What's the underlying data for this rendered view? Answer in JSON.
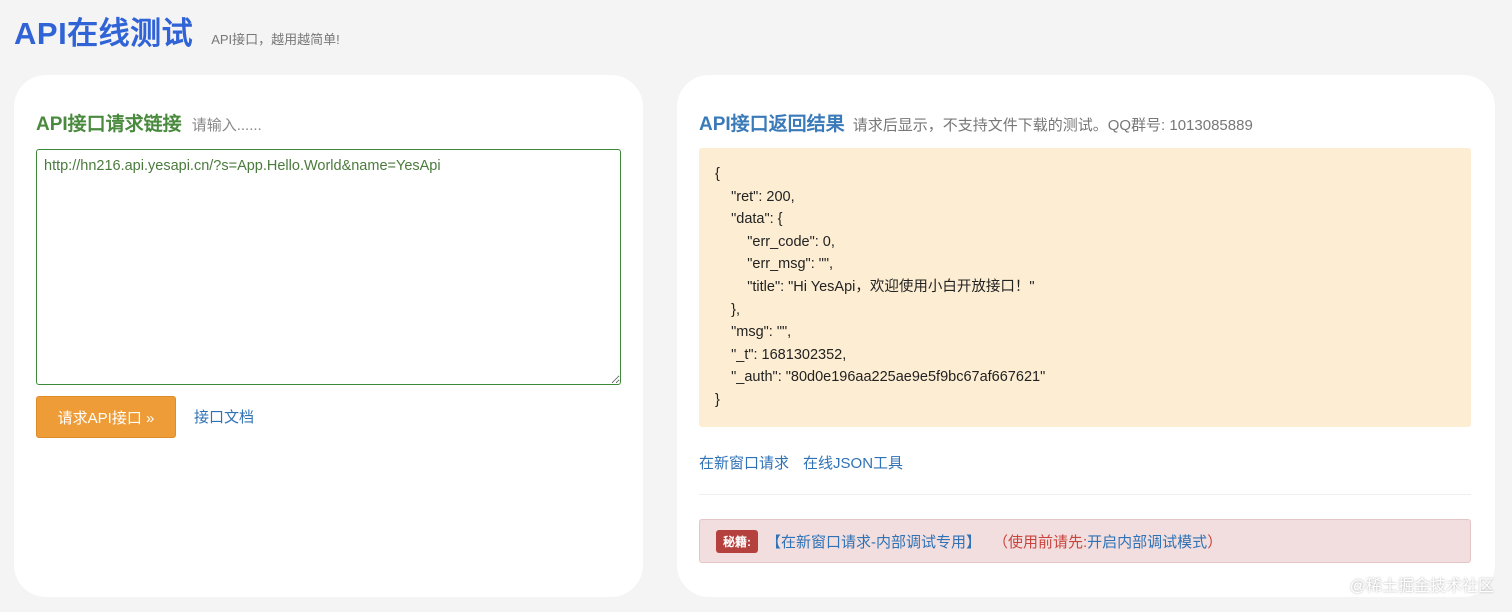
{
  "header": {
    "title": "API在线测试",
    "subtitle": "API接口，越用越简单!"
  },
  "request_panel": {
    "title": "API接口请求链接",
    "hint": "请输入......",
    "url_value": "http://hn216.api.yesapi.cn/?s=App.Hello.World&name=YesApi",
    "submit_label": "请求API接口 »",
    "docs_link": "接口文档"
  },
  "result_panel": {
    "title": "API接口返回结果",
    "hint": "请求后显示，不支持文件下载的测试。QQ群号: 1013085889",
    "json_lines": [
      "{",
      "    \"ret\": 200,",
      "    \"data\": {",
      "        \"err_code\": 0,",
      "        \"err_msg\": \"\",",
      "        \"title\": \"Hi YesApi，欢迎使用小白开放接口！\"",
      "    },",
      "    \"msg\": \"\",",
      "    \"_t\": 1681302352,",
      "    \"_auth\": \"80d0e196aa225ae9e5f9bc67af667621\"",
      "}"
    ],
    "links": {
      "new_window": "在新窗口请求",
      "json_tool": "在线JSON工具"
    },
    "tip": {
      "badge": "秘籍:",
      "link": "【在新窗口请求-内部调试专用】",
      "note_prefix": "（使用前请先:",
      "note_link": "开启内部调试模式",
      "note_suffix": "）"
    }
  },
  "watermark": "@稀土掘金技术社区",
  "colors": {
    "background": "#f4f4f5",
    "title_blue": "#2f63d6",
    "left_heading_green": "#4a8a3e",
    "right_heading_blue": "#3a7ab8",
    "button_orange": "#ed9c38",
    "result_bg": "#fdeed3",
    "tip_bg": "#f2dede",
    "badge_red": "#b5413e"
  }
}
